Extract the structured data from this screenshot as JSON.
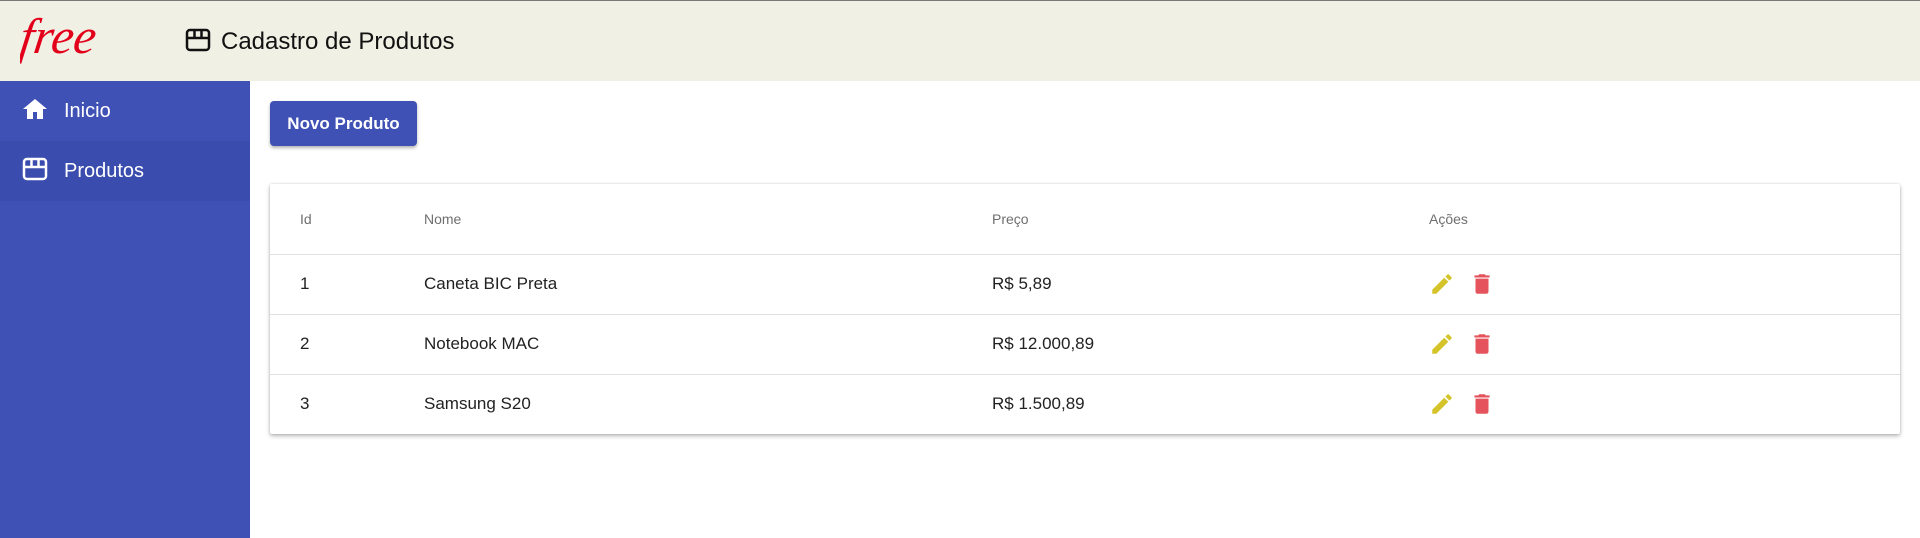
{
  "header": {
    "logo_text": "free",
    "title": "Cadastro de Produtos",
    "title_icon": "store-icon"
  },
  "sidebar": {
    "items": [
      {
        "label": "Inicio",
        "icon": "home-icon",
        "active": false
      },
      {
        "label": "Produtos",
        "icon": "store-icon",
        "active": true
      }
    ]
  },
  "toolbar": {
    "new_product_label": "Novo Produto"
  },
  "table": {
    "headers": [
      "Id",
      "Nome",
      "Preço",
      "Ações"
    ],
    "rows": [
      {
        "id": "1",
        "nome": "Caneta BIC Preta",
        "preco": "R$ 5,89"
      },
      {
        "id": "2",
        "nome": "Notebook MAC",
        "preco": "R$ 12.000,89"
      },
      {
        "id": "3",
        "nome": "Samsung S20",
        "preco": "R$ 1.500,89"
      }
    ]
  },
  "colors": {
    "primary": "#3f51b5",
    "header_bg": "#f1f0e4",
    "logo_red": "#e2001a",
    "edit_icon": "#d4c42a",
    "delete_icon": "#e5535d"
  }
}
